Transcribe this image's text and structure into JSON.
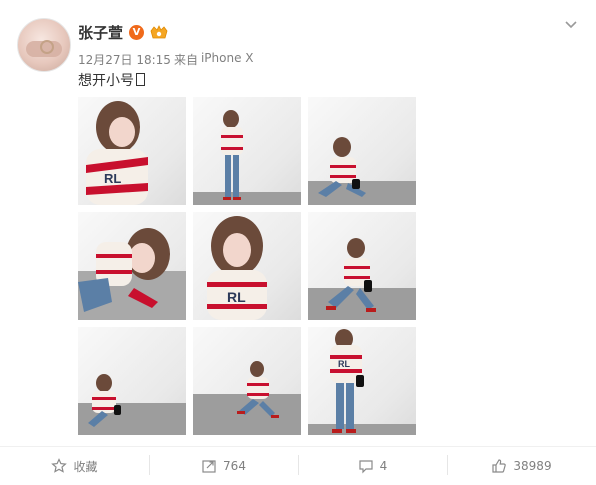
{
  "user": {
    "name": "张子萱",
    "verified_badge": "V",
    "avatar_icon": "avatar",
    "member_icon": "vip-member-icon"
  },
  "post": {
    "meta": {
      "date": "12月27日 18:15",
      "source_prefix": "来自",
      "source": "iPhone X"
    },
    "text": "想开小号",
    "images_count": 9
  },
  "actions": {
    "favorite_label": "收藏",
    "repost_count": "764",
    "comment_count": "4",
    "like_count": "38989"
  },
  "colors": {
    "accent_orange": "#f06a1b",
    "text_gray": "#808080",
    "sweater_red": "#c8102e",
    "jeans_blue": "#5b7fa6",
    "floor_gray": "#9d9d9d"
  }
}
